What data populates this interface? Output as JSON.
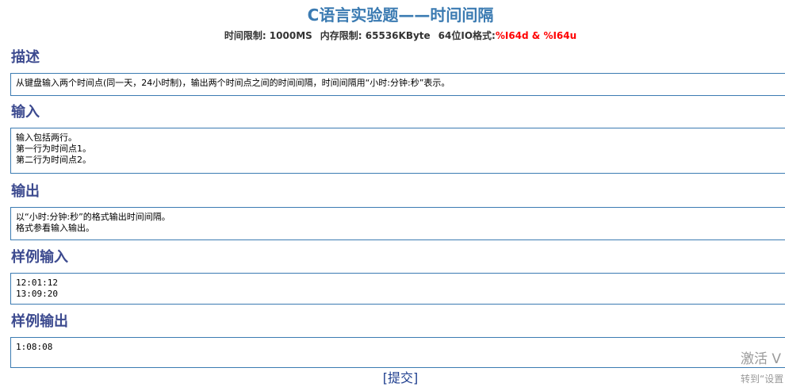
{
  "title": "C语言实验题——时间间隔",
  "meta": {
    "time_limit": "时间限制: 1000MS",
    "memory_limit": "内存限制: 65536KByte",
    "io_format_label": "64位IO格式:",
    "io_format_value": "%I64d & %I64u"
  },
  "sections": {
    "description": {
      "heading": "描述",
      "lines": [
        "从键盘输入两个时间点(同一天，24小时制)，输出两个时间点之间的时间间隔，时间间隔用“小时:分钟:秒”表示。"
      ]
    },
    "input": {
      "heading": "输入",
      "lines": [
        "输入包括两行。",
        "第一行为时间点1。",
        "第二行为时间点2。"
      ]
    },
    "output": {
      "heading": "输出",
      "lines": [
        "以“小时:分钟:秒”的格式输出时间间隔。",
        "格式参看输入输出。"
      ]
    },
    "sample_input": {
      "heading": "样例输入",
      "lines": [
        "12:01:12",
        "13:09:20"
      ]
    },
    "sample_output": {
      "heading": "样例输出",
      "lines": [
        "1:08:08"
      ]
    }
  },
  "submit": {
    "open_bracket": "[",
    "label": "提交",
    "close_bracket": "]"
  },
  "watermark": {
    "line1": "激活 V",
    "line2": "转到“设置"
  }
}
